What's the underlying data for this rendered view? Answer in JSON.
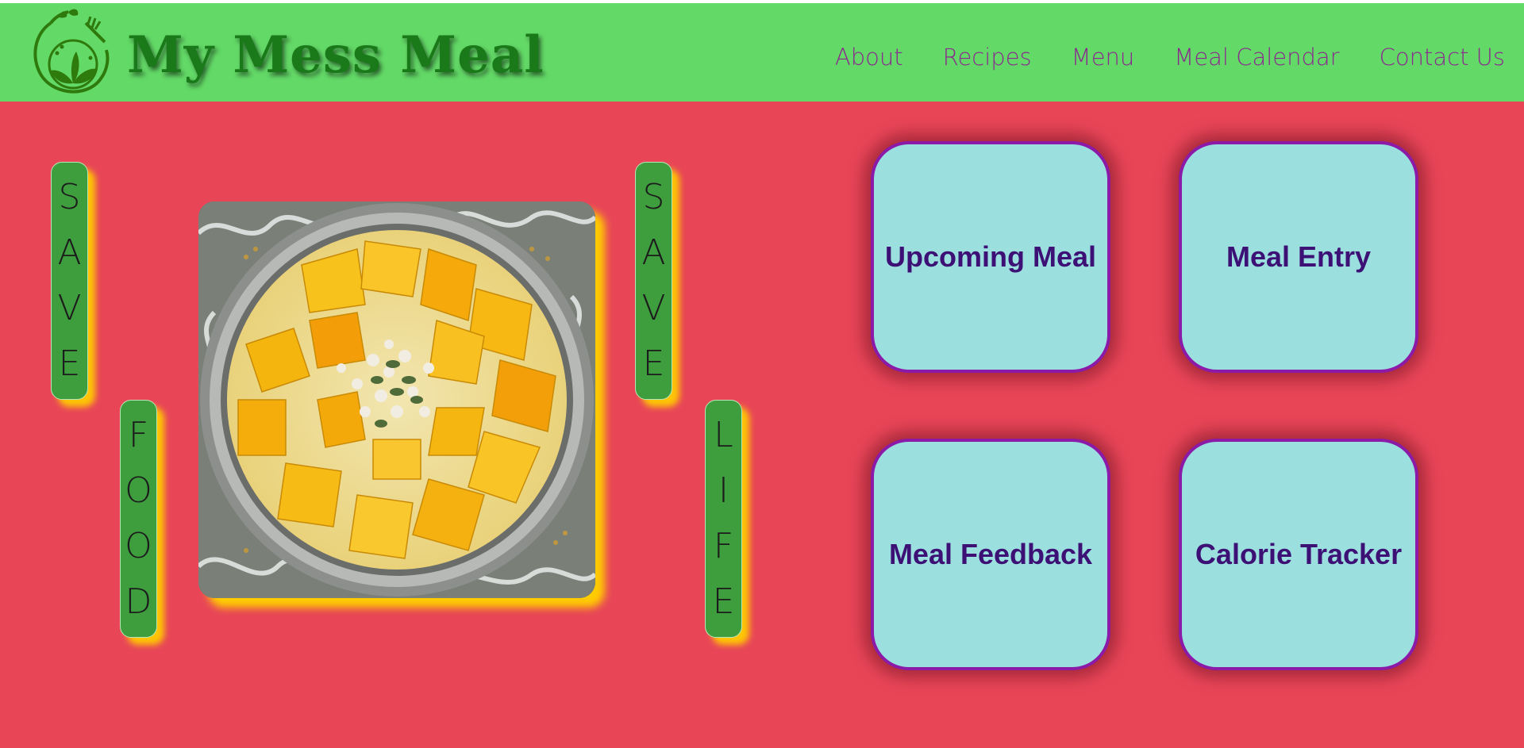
{
  "header": {
    "title": "My Mess Meal",
    "logo_icon": "leaf-fork-icon",
    "nav": [
      "About",
      "Recipes",
      "Menu",
      "Meal Calendar",
      "Contact Us"
    ]
  },
  "slogan": {
    "word1": [
      "S",
      "A",
      "V",
      "E"
    ],
    "word2": [
      "F",
      "O",
      "O",
      "D"
    ],
    "word3": [
      "S",
      "A",
      "V",
      "E"
    ],
    "word4": [
      "L",
      "I",
      "F",
      "E"
    ]
  },
  "cards": {
    "upcoming": "Upcoming Meal",
    "entry": "Meal Entry",
    "feedback": "Meal Feedback",
    "calorie": "Calorie Tracker"
  },
  "colors": {
    "header_bg": "#63d967",
    "main_bg": "#e84657",
    "pill_bg": "#3e9e3e",
    "card_bg": "#9be0df",
    "card_border": "#8b1aa8",
    "card_text": "#3d1075",
    "nav_text": "#8a2a8e",
    "glow": "#ffcc00"
  },
  "photo": {
    "subject": "mango-dessert-bowl"
  }
}
